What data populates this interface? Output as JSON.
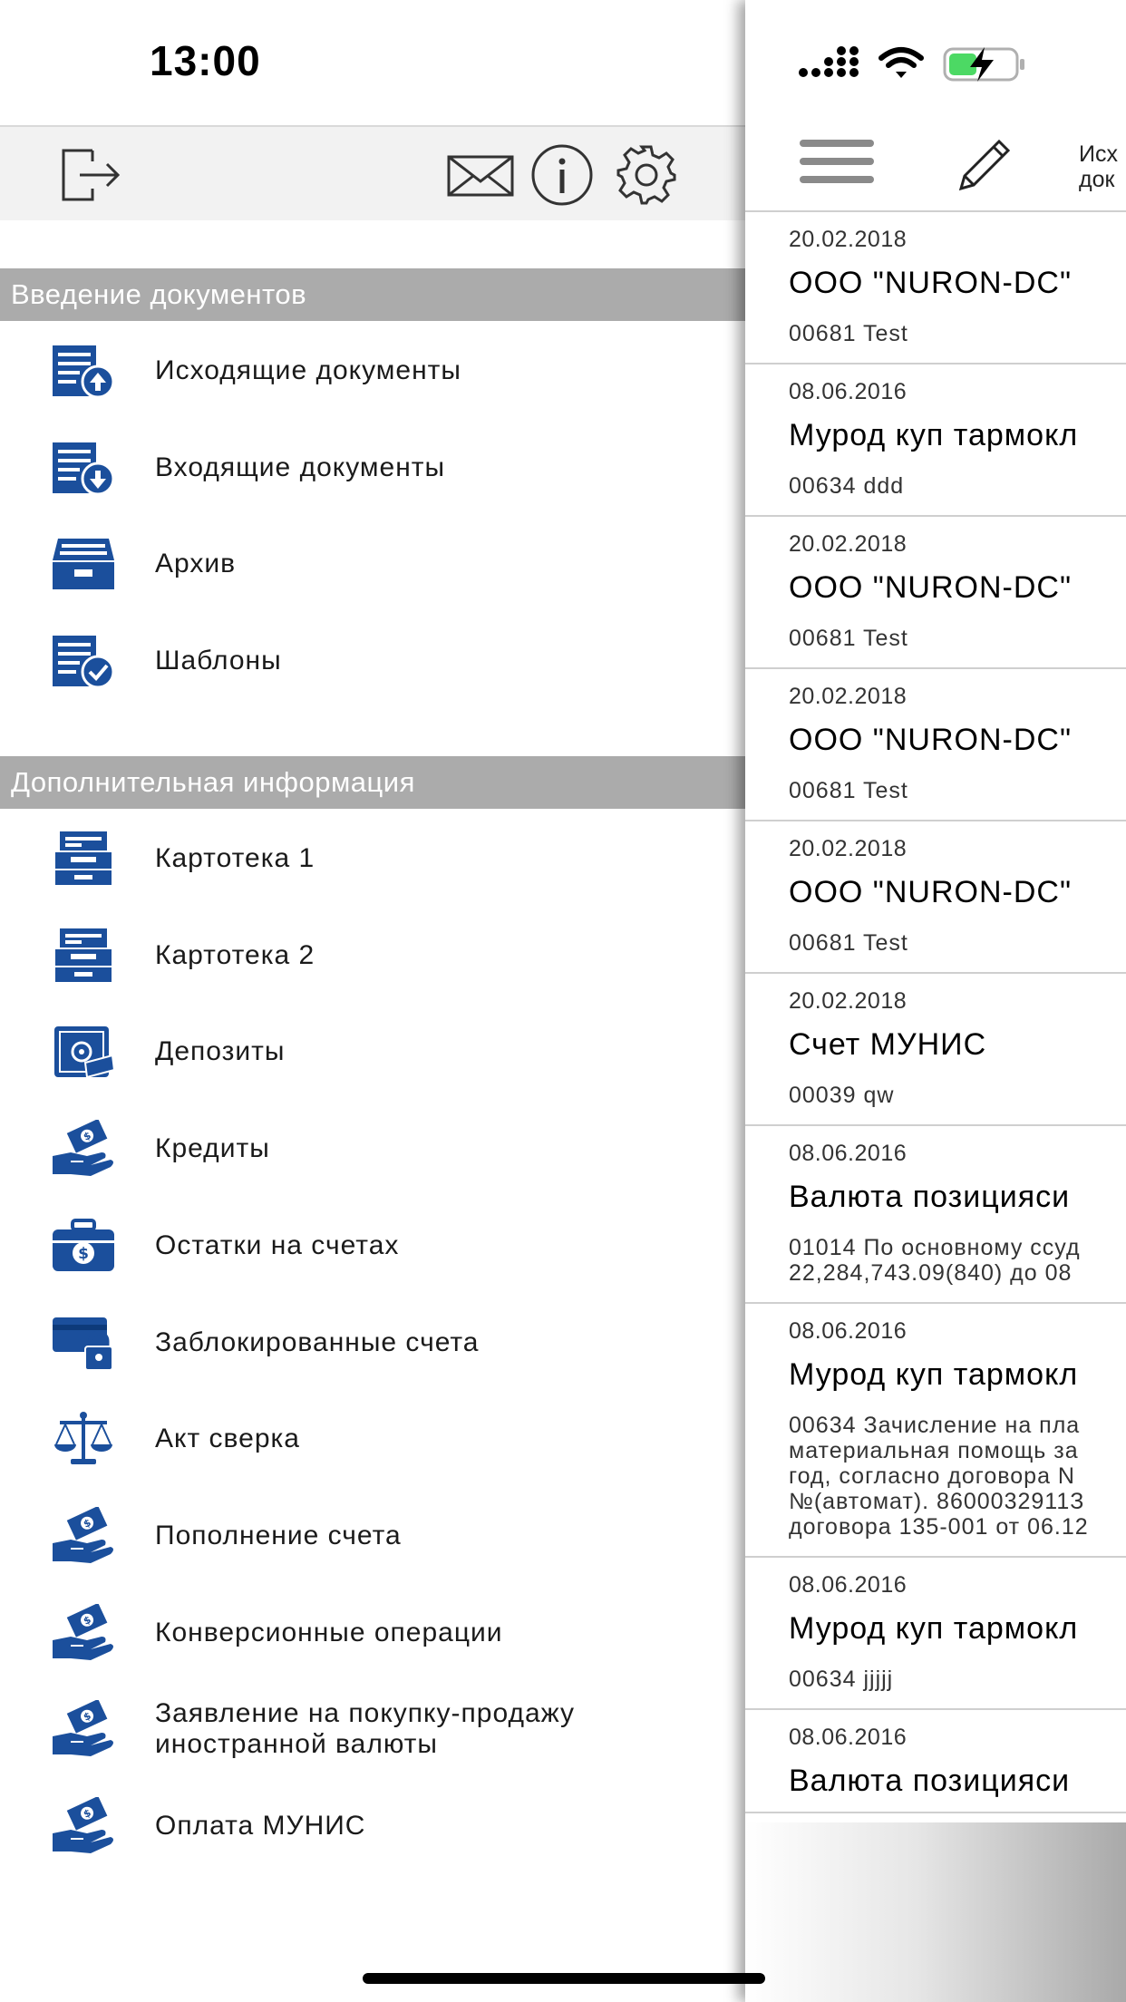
{
  "status_bar": {
    "time": "13:00"
  },
  "drawer": {
    "sections": [
      {
        "header": "Введение документов",
        "items": [
          {
            "label": "Исходящие документы",
            "icon": "outgoing-documents-icon"
          },
          {
            "label": "Входящие документы",
            "icon": "incoming-documents-icon"
          },
          {
            "label": "Архив",
            "icon": "archive-icon"
          },
          {
            "label": "Шаблоны",
            "icon": "templates-icon"
          }
        ]
      },
      {
        "header": "Дополнительная информация",
        "items": [
          {
            "label": "Картотека 1",
            "icon": "card-index-icon"
          },
          {
            "label": "Картотека 2",
            "icon": "card-index-icon"
          },
          {
            "label": "Депозиты",
            "icon": "deposit-safe-icon"
          },
          {
            "label": "Кредиты",
            "icon": "money-hand-icon"
          },
          {
            "label": "Остатки на счетах",
            "icon": "money-briefcase-icon"
          },
          {
            "label": "Заблокированные счета",
            "icon": "locked-card-icon"
          },
          {
            "label": "Акт сверка",
            "icon": "scales-icon"
          },
          {
            "label": "Пополнение счета",
            "icon": "money-hand-icon"
          },
          {
            "label": "Конверсионные операции",
            "icon": "money-hand-icon"
          },
          {
            "label": "Заявление на покупку-продажу\nиностранной валюты",
            "icon": "money-hand-icon"
          },
          {
            "label": "Оплата МУНИС",
            "icon": "money-hand-icon"
          }
        ]
      }
    ]
  },
  "panel": {
    "title": "Исх\nдок",
    "documents": [
      {
        "date": "20.02.2018",
        "title": "ООО \"NURON-DC\"",
        "subtitle": "00681 Test"
      },
      {
        "date": "08.06.2016",
        "title": "Мурод куп тармокл",
        "subtitle": "00634 ddd"
      },
      {
        "date": "20.02.2018",
        "title": "ООО \"NURON-DC\"",
        "subtitle": "00681 Test"
      },
      {
        "date": "20.02.2018",
        "title": "ООО \"NURON-DC\"",
        "subtitle": "00681 Test"
      },
      {
        "date": "20.02.2018",
        "title": "ООО \"NURON-DC\"",
        "subtitle": "00681 Test"
      },
      {
        "date": "20.02.2018",
        "title": "Счет МУНИС",
        "subtitle": "00039 qw"
      },
      {
        "date": "08.06.2016",
        "title": "Валюта позицияси",
        "subtitle": "01014 По основному ссуд\n22,284,743.09(840) до 08"
      },
      {
        "date": "08.06.2016",
        "title": "Мурод куп тармокл",
        "subtitle": "00634 Зачисление на пла\nматериальная помощь за\nгод, согласно договора N\n№(автомат). 8600032911З\nдоговора 135-001 от 06.12"
      },
      {
        "date": "08.06.2016",
        "title": "Мурод куп тармокл",
        "subtitle": "00634 jjjjj"
      },
      {
        "date": "08.06.2016",
        "title": "Валюта позицияси",
        "subtitle": ""
      }
    ]
  },
  "colors": {
    "icon_blue": "#1b4f9c",
    "section_gray": "#ababab",
    "battery_green": "#4cd964"
  }
}
